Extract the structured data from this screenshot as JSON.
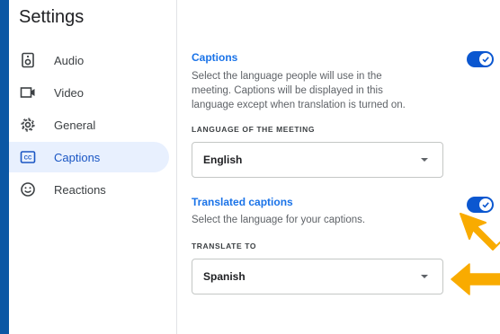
{
  "sidebar": {
    "title": "Settings",
    "items": [
      {
        "label": "Audio",
        "icon": "speaker-icon",
        "active": false
      },
      {
        "label": "Video",
        "icon": "video-camera-icon",
        "active": false
      },
      {
        "label": "General",
        "icon": "gear-icon",
        "active": false
      },
      {
        "label": "Captions",
        "icon": "closed-captions-icon",
        "active": true
      },
      {
        "label": "Reactions",
        "icon": "smiley-icon",
        "active": false
      }
    ]
  },
  "captions": {
    "title": "Captions",
    "description": "Select the language people will use in the meeting. Captions will be displayed in this language except when translation is turned on.",
    "toggle_on": true,
    "language_label": "LANGUAGE OF THE MEETING",
    "language_value": "English"
  },
  "translated": {
    "title": "Translated captions",
    "description": "Select the language for your captions.",
    "toggle_on": true,
    "translate_label": "TRANSLATE TO",
    "translate_value": "Spanish"
  },
  "colors": {
    "accent": "#1a73e8",
    "active_nav_bg": "#e8f0fe",
    "annotation_arrow": "#f9ab00",
    "frame_border": "#0b57a4"
  }
}
